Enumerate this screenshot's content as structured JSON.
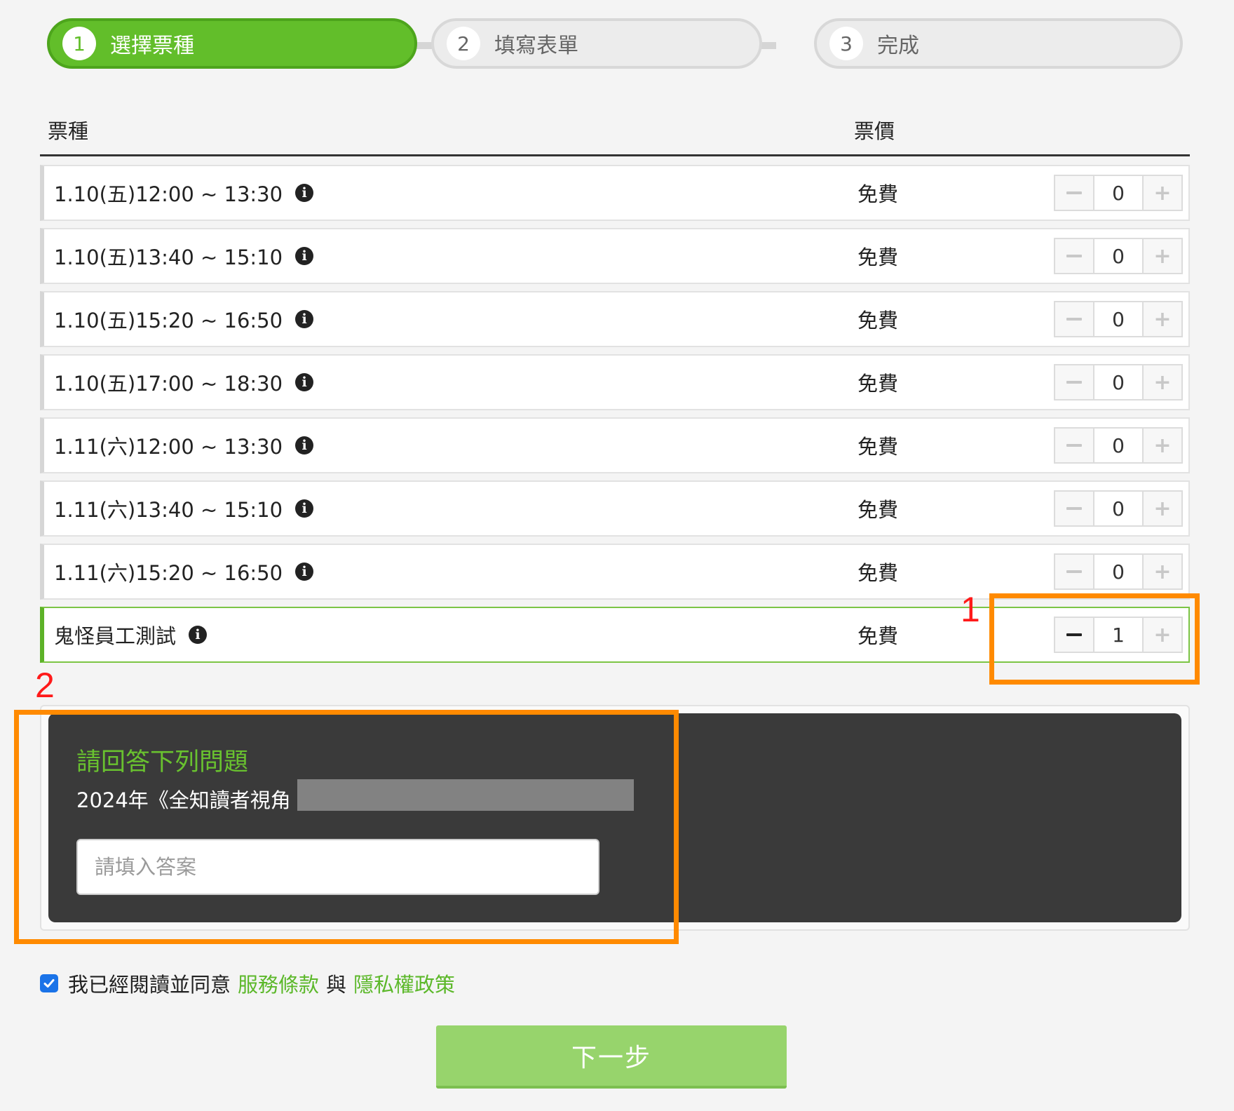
{
  "steps": [
    {
      "num": "1",
      "label": "選擇票種",
      "state": "active"
    },
    {
      "num": "2",
      "label": "填寫表單",
      "state": "inactive"
    },
    {
      "num": "3",
      "label": "完成",
      "state": "inactive"
    }
  ],
  "table": {
    "col_ticket": "票種",
    "col_price": "票價",
    "rows": [
      {
        "name": "1.10(五)12:00 ~ 13:30",
        "price": "免費",
        "qty": "0"
      },
      {
        "name": "1.10(五)13:40 ~ 15:10",
        "price": "免費",
        "qty": "0"
      },
      {
        "name": "1.10(五)15:20 ~ 16:50",
        "price": "免費",
        "qty": "0"
      },
      {
        "name": "1.10(五)17:00 ~ 18:30",
        "price": "免費",
        "qty": "0"
      },
      {
        "name": "1.11(六)12:00 ~ 13:30",
        "price": "免費",
        "qty": "0"
      },
      {
        "name": "1.11(六)13:40 ~ 15:10",
        "price": "免費",
        "qty": "0"
      },
      {
        "name": "1.11(六)15:20 ~ 16:50",
        "price": "免費",
        "qty": "0"
      },
      {
        "name": "鬼怪員工測試",
        "price": "免費",
        "qty": "1"
      }
    ],
    "info_icon_glyph": "i",
    "minus_glyph": "−",
    "plus_glyph": "+"
  },
  "annotations": {
    "label_1": "1",
    "label_2": "2",
    "color": "#ff8a00",
    "label_color": "#ff1a1a"
  },
  "question": {
    "title": "請回答下列問題",
    "text": "2024年《全知讀者視角",
    "placeholder": "請填入答案",
    "value": ""
  },
  "agreement": {
    "checked": true,
    "prefix": "我已經閱讀並同意",
    "terms_link": "服務條款",
    "conjunction": "與",
    "privacy_link": "隱私權政策"
  },
  "next_button": "下一步",
  "colors": {
    "brand_green": "#62be2a",
    "link_green": "#5cb82a",
    "panel_dark": "#3a3a3a",
    "next_button": "#97d46c",
    "checkbox_blue": "#1a73e8"
  }
}
